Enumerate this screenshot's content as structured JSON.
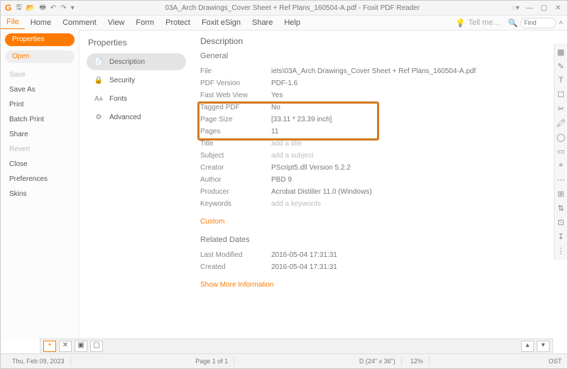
{
  "titlebar": {
    "doc_title": "03A_Arch Drawings_Cover Sheet + Ref Plans_160504-A.pdf - Foxit PDF Reader"
  },
  "ribbon": {
    "tabs": [
      "File",
      "Home",
      "Comment",
      "View",
      "Form",
      "Protect",
      "Foxit eSign",
      "Share",
      "Help"
    ],
    "tellme": "Tell me…",
    "find": "Find"
  },
  "leftnav": {
    "properties": "Properties",
    "open": "Open",
    "items": [
      "Save",
      "Save As",
      "Print",
      "Batch Print",
      "Share",
      "Revert",
      "Close",
      "Preferences",
      "Skins"
    ],
    "dim": [
      "Save",
      "Revert"
    ]
  },
  "props_cats": {
    "title": "Properties",
    "items": [
      {
        "icon": "📄",
        "label": "Description"
      },
      {
        "icon": "🔒",
        "label": "Security"
      },
      {
        "icon": "Aᴀ",
        "label": "Fonts"
      },
      {
        "icon": "⚙",
        "label": "Advanced"
      }
    ]
  },
  "desc": {
    "title": "Description",
    "general": "General",
    "rows": [
      {
        "k": "File",
        "v": "iets\\03A_Arch Drawings_Cover Sheet + Ref Plans_160504-A.pdf"
      },
      {
        "k": "PDF Version",
        "v": "PDF-1.6"
      },
      {
        "k": "Fast Web View",
        "v": "Yes"
      },
      {
        "k": "Tagged PDF",
        "v": "No"
      },
      {
        "k": "Page Size",
        "v": "[33.11 * 23.39 inch]"
      },
      {
        "k": "Pages",
        "v": "11"
      },
      {
        "k": "Title",
        "v": "add a title",
        "ph": true
      },
      {
        "k": "Subject",
        "v": "add a subject",
        "ph": true
      },
      {
        "k": "Creator",
        "v": "PScript5.dll Version 5.2.2"
      },
      {
        "k": "Author",
        "v": "PBD 9"
      },
      {
        "k": "Producer",
        "v": "Acrobat Distiller 11.0 (Windows)"
      },
      {
        "k": "Keywords",
        "v": "add a keywords",
        "ph": true
      }
    ],
    "custom": "Custom",
    "related": "Related Dates",
    "dates": [
      {
        "k": "Last Modified",
        "v": "2016-05-04 17:31:31"
      },
      {
        "k": "Created",
        "v": "2016-05-04 17:31:31"
      }
    ],
    "more": "Show More Information"
  },
  "status": {
    "date": "Thu, Feb 09, 2023",
    "page": "Page 1 of 1",
    "dims": "D (24\" x 36\")",
    "zoom": "12%",
    "ost": "OST"
  }
}
